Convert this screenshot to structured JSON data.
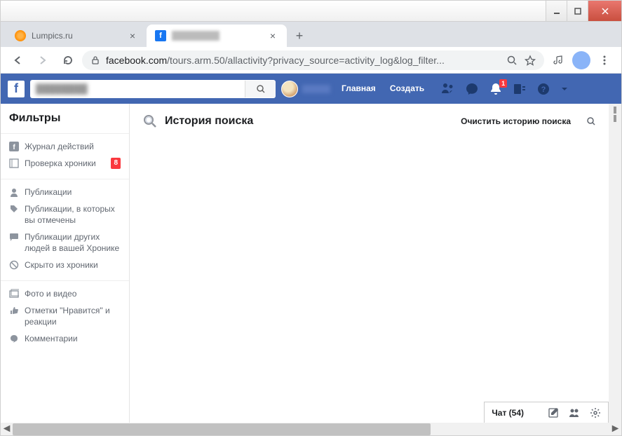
{
  "window": {
    "tabs": [
      {
        "title": "Lumpics.ru",
        "active": false
      },
      {
        "title": "Facebook",
        "active": true
      }
    ]
  },
  "browser": {
    "url_domain": "facebook.com",
    "url_path": "/tours.arm.50/allactivity?privacy_source=activity_log&log_filter..."
  },
  "fb_header": {
    "nav_home": "Главная",
    "nav_create": "Создать",
    "notif_badge": "1"
  },
  "sidebar": {
    "title": "Фильтры",
    "group1": [
      {
        "label": "Журнал действий",
        "icon": "fb"
      },
      {
        "label": "Проверка хроники",
        "icon": "timeline",
        "badge": "8"
      }
    ],
    "group2": [
      {
        "label": "Публикации",
        "icon": "person"
      },
      {
        "label": "Публикации, в которых вы отмечены",
        "icon": "tag"
      },
      {
        "label": "Публикации других людей в вашей Хронике",
        "icon": "comment"
      },
      {
        "label": "Скрыто из хроники",
        "icon": "hidden"
      }
    ],
    "group3": [
      {
        "label": "Фото и видео",
        "icon": "photo"
      },
      {
        "label": "Отметки \"Нравится\" и реакции",
        "icon": "like"
      },
      {
        "label": "Комментарии",
        "icon": "speech"
      }
    ]
  },
  "main": {
    "title": "История поиска",
    "clear_link": "Очистить историю поиска"
  },
  "chat": {
    "label": "Чат (54)"
  }
}
